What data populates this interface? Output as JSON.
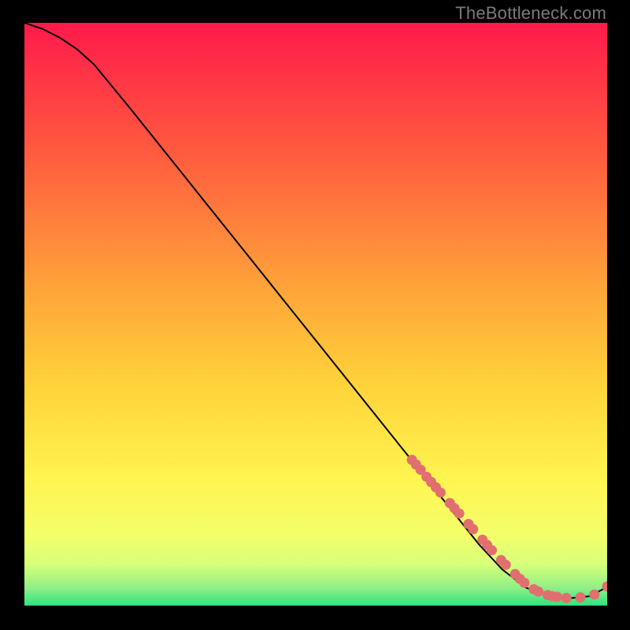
{
  "watermark": "TheBottleneck.com",
  "chart_data": {
    "type": "line",
    "title": "",
    "xlabel": "",
    "ylabel": "",
    "xlim": [
      0,
      100
    ],
    "ylim": [
      0,
      100
    ],
    "grid": false,
    "background_gradient": {
      "top": "#ff1a4b",
      "mid_upper": "#ff7a3a",
      "mid": "#ffd23a",
      "mid_lower": "#fff450",
      "near_bottom": "#d6ff7a",
      "bottom": "#2fe27f"
    },
    "series": [
      {
        "name": "curve",
        "color": "#000000",
        "x": [
          0,
          3,
          6,
          9,
          12,
          18,
          24,
          30,
          36,
          42,
          48,
          54,
          60,
          66,
          72,
          78,
          82,
          86,
          90,
          94,
          97,
          100
        ],
        "y": [
          100,
          99,
          97.5,
          95.5,
          92.8,
          85.5,
          78,
          70.5,
          63,
          55.5,
          48,
          40.5,
          33,
          25.5,
          18,
          10.5,
          6.2,
          3.1,
          1.6,
          1.3,
          1.6,
          3.2
        ]
      }
    ],
    "scatter": [
      {
        "name": "markers",
        "color": "#e26f6f",
        "x": [
          66.5,
          67.2,
          68.0,
          69.0,
          69.8,
          70.6,
          71.4,
          73.0,
          73.8,
          74.6,
          76.2,
          77.0,
          78.6,
          79.4,
          80.2,
          81.8,
          82.6,
          84.2,
          85.0,
          85.8,
          87.4,
          88.2,
          89.8,
          90.6,
          91.4,
          93.0,
          95.4,
          97.8,
          100.0
        ],
        "y": [
          25.0,
          24.2,
          23.3,
          22.1,
          21.2,
          20.3,
          19.4,
          17.6,
          16.7,
          15.8,
          14.0,
          13.1,
          11.3,
          10.4,
          9.5,
          7.8,
          7.0,
          5.4,
          4.6,
          3.9,
          2.8,
          2.4,
          1.8,
          1.6,
          1.5,
          1.3,
          1.4,
          1.9,
          3.3
        ]
      }
    ]
  }
}
